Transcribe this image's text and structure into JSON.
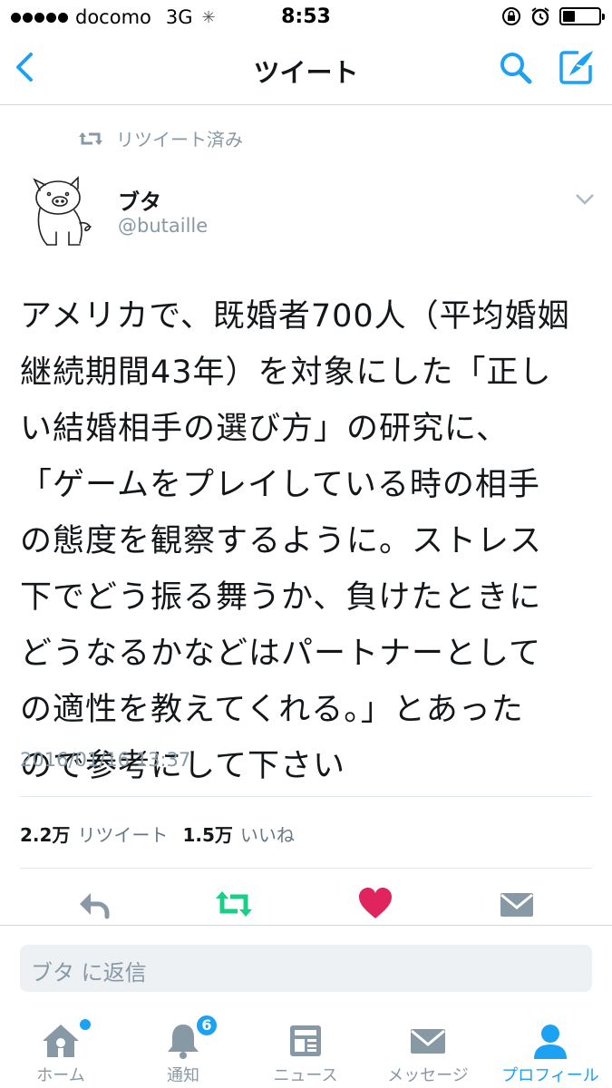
{
  "status_bar": {
    "carrier": "docomo",
    "network": "3G",
    "time": "8:53",
    "battery_level": 0.35
  },
  "nav": {
    "title": "ツイート",
    "icons": [
      "back-icon",
      "search-icon",
      "compose-icon"
    ]
  },
  "tweet": {
    "retweeted_label": "リツイート済み",
    "user_name": "ブタ",
    "user_handle": "@butaille",
    "lines": [
      "アメリカで、既婚者700人（平均婚姻",
      "継続期間43年）を対象にした「正し",
      "い結婚相手の選び方」の研究に、",
      "「ゲームをプレイしている時の相手",
      "の態度を観察するように。ストレス",
      "下でどう振る舞うか、負けたときに",
      "どうなるかなどはパートナーとして",
      "の適性を教えてくれる。」とあった",
      "ので参考にして下さい"
    ],
    "timestamp": "2016/01/16 13:37",
    "retweet_count": "2.2万",
    "retweet_label": "リツイート",
    "like_count": "1.5万",
    "like_label": "いいね"
  },
  "actions": {
    "icons": [
      "reply-icon",
      "retweet-icon",
      "like-icon",
      "dm-icon"
    ],
    "colors": {
      "retweet": "#19cf86",
      "like": "#e0245e",
      "default": "#8899a6"
    }
  },
  "reply": {
    "placeholder": "ブタ に返信"
  },
  "tabs": [
    {
      "label": "ホーム",
      "icon": "home-icon"
    },
    {
      "label": "通知",
      "icon": "bell-icon",
      "badge": "6"
    },
    {
      "label": "ニュース",
      "icon": "news-icon"
    },
    {
      "label": "メッセージ",
      "icon": "envelope-icon"
    },
    {
      "label": "プロフィール",
      "icon": "profile-icon",
      "active": true
    }
  ],
  "colors": {
    "accent": "#1da1f2",
    "muted": "#8899a6",
    "text": "#14171a"
  }
}
